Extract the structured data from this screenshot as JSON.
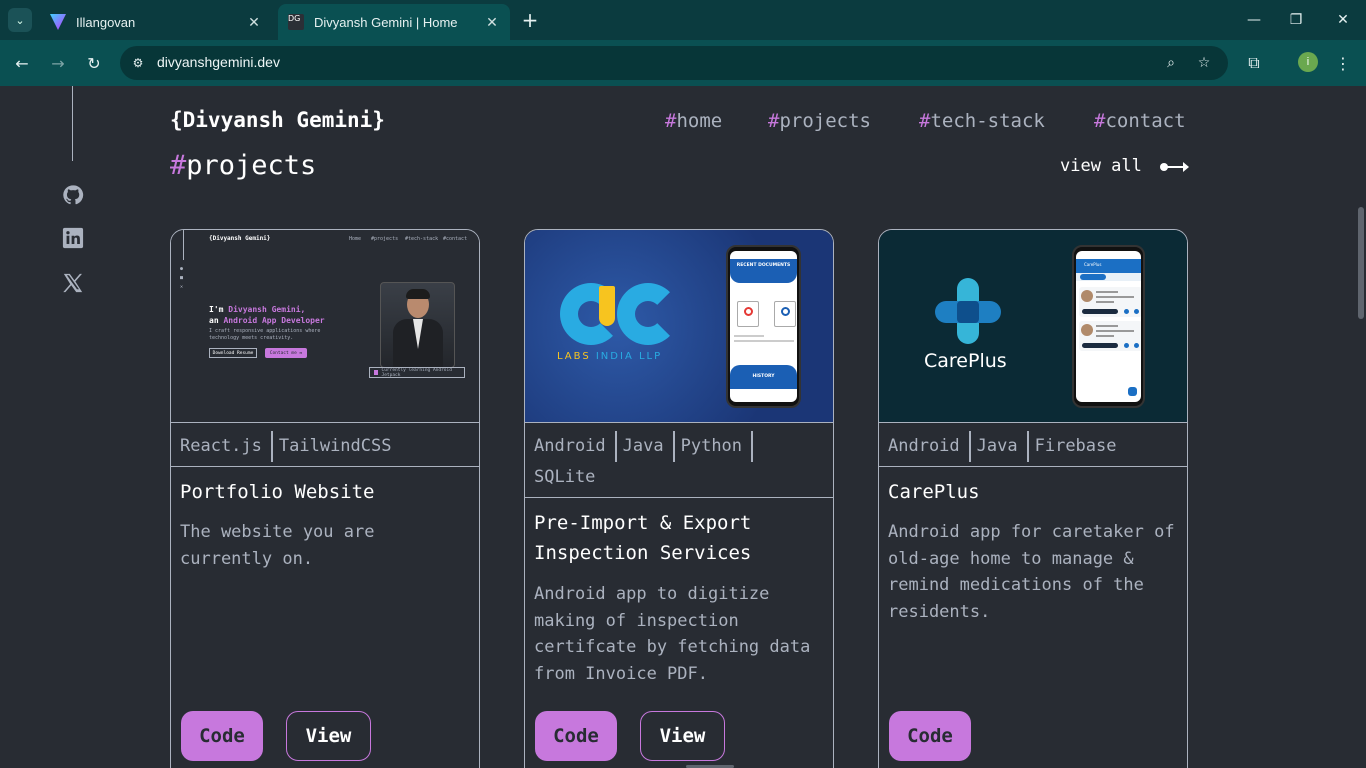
{
  "browser": {
    "tabs": [
      {
        "title": "Illangovan",
        "favicon": "vite-icon",
        "active": false
      },
      {
        "title": "Divyansh Gemini | Home",
        "favicon": "DG",
        "active": true
      }
    ],
    "url": "divyanshgemini.dev",
    "profile_initial": "i"
  },
  "site": {
    "logo": "{Divyansh Gemini}",
    "nav": [
      {
        "hash": "#",
        "label": "home"
      },
      {
        "hash": "#",
        "label": "projects"
      },
      {
        "hash": "#",
        "label": "tech-stack"
      },
      {
        "hash": "#",
        "label": "contact"
      }
    ],
    "social": [
      "github-icon",
      "linkedin-icon",
      "x-icon"
    ],
    "section": {
      "hash": "#",
      "title": "projects"
    },
    "view_all": "view all"
  },
  "thumb1": {
    "logo": "{Divyansh Gemini}",
    "nav": [
      "Home",
      "#projects",
      "#tech-stack",
      "#contact"
    ],
    "hero_prefix": "I'm ",
    "hero_name": "Divyansh Gemini,",
    "hero_an": "an ",
    "hero_role": "Android App Developer",
    "sub": "I craft responsive applications where technology meets creativity.",
    "btn_resume": "Download Resume",
    "btn_contact": "Contact me ✉",
    "badge": "Currently learning Android Jetpack"
  },
  "thumb2": {
    "labs_a": "LABS ",
    "labs_b": "INDIA LLP",
    "recent": "RECENT DOCUMENTS",
    "history": "HISTORY"
  },
  "thumb3": {
    "brand": "CarePlus",
    "app_header": "CarePlus"
  },
  "projects": [
    {
      "tags": [
        "React.js",
        "TailwindCSS"
      ],
      "title": "Portfolio Website",
      "desc": "The website you are currently on.",
      "code_label": "Code",
      "view_label": "View"
    },
    {
      "tags": [
        "Android",
        "Java",
        "Python",
        "SQLite"
      ],
      "title": "Pre-Import & Export Inspection Services",
      "desc": "Android app to digitize making of inspection certifcate by fetching data from Invoice PDF.",
      "code_label": "Code",
      "view_label": "View"
    },
    {
      "tags": [
        "Android",
        "Java",
        "Firebase"
      ],
      "title": "CarePlus",
      "desc": "Android app for caretaker of old-age home to manage & remind medications of the residents.",
      "code_label": "Code"
    }
  ],
  "colors": {
    "accent": "#c778dd",
    "bg": "#282c33",
    "muted": "#abb2bf",
    "chrome": "#0a5052"
  }
}
